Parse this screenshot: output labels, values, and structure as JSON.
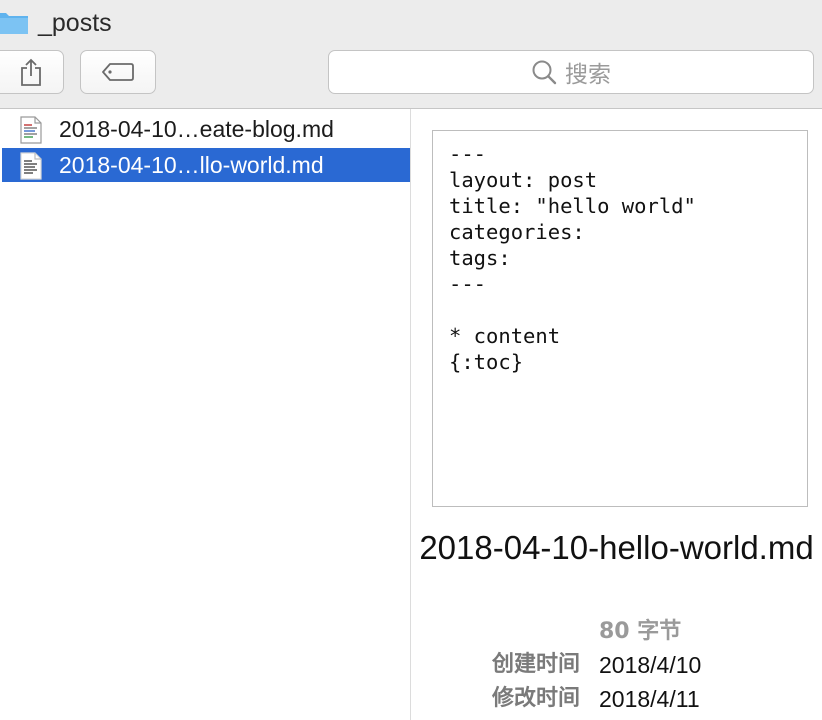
{
  "window": {
    "title": "_posts",
    "folder_icon": "folder-icon"
  },
  "toolbar": {
    "share_icon": "share-icon",
    "tag_icon": "tag-icon",
    "search": {
      "icon": "search-icon",
      "placeholder": "搜索"
    }
  },
  "files": [
    {
      "name": "2018-04-10…eate-blog.md",
      "icon": "markdown-file-icon",
      "selected": false
    },
    {
      "name": "2018-04-10…llo-world.md",
      "icon": "markdown-file-icon",
      "selected": true
    }
  ],
  "preview": {
    "content": "---\nlayout: post\ntitle: \"hello world\"\ncategories:\ntags:\n---\n\n* content\n{:toc}",
    "filename": "2018-04-10-hello-world.md",
    "size": "80 字节",
    "meta": [
      {
        "label": "创建时间",
        "value": "2018/4/10"
      },
      {
        "label": "修改时间",
        "value": "2018/4/11"
      }
    ]
  },
  "colors": {
    "selection": "#2a69d3",
    "folder": "#5fb3ee",
    "chrome": "#ececec"
  }
}
